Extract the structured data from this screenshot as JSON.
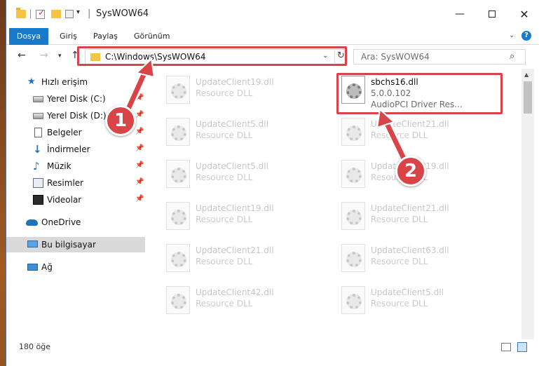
{
  "window": {
    "title": "SysWOW64"
  },
  "ribbon": {
    "tabs": [
      {
        "label": "Dosya"
      },
      {
        "label": "Giriş"
      },
      {
        "label": "Paylaş"
      },
      {
        "label": "Görünüm"
      }
    ],
    "help": "?"
  },
  "nav": {
    "address": "C:\\Windows\\SysWOW64",
    "search_placeholder": "Ara: SysWOW64"
  },
  "sidebar": {
    "items": [
      {
        "label": "Hızlı erişim",
        "icon": "star-icon"
      },
      {
        "label": "Yerel Disk (C:)",
        "icon": "drive-icon",
        "pinned": true
      },
      {
        "label": "Yerel Disk (D:)",
        "icon": "drive-icon",
        "pinned": true
      },
      {
        "label": "Belgeler",
        "icon": "document-icon",
        "pinned": true
      },
      {
        "label": "İndirmeler",
        "icon": "download-icon",
        "pinned": true
      },
      {
        "label": "Müzik",
        "icon": "music-icon",
        "pinned": true
      },
      {
        "label": "Resimler",
        "icon": "picture-icon",
        "pinned": true
      },
      {
        "label": "Videolar",
        "icon": "video-icon",
        "pinned": true
      },
      {
        "label": "OneDrive",
        "icon": "cloud-icon"
      },
      {
        "label": "Bu bilgisayar",
        "icon": "computer-icon",
        "selected": true
      },
      {
        "label": "Ağ",
        "icon": "network-icon"
      }
    ]
  },
  "files": {
    "left_column": [
      {
        "name": "UpdateClient19.dll",
        "type": "Resource DLL"
      },
      {
        "name": "UpdateClient5.dll",
        "type": "Resource DLL"
      },
      {
        "name": "UpdateClient5.dll",
        "type": "Resource DLL"
      },
      {
        "name": "UpdateClient19.dll",
        "type": "Resource DLL"
      },
      {
        "name": "UpdateClient21.dll",
        "type": "Resource DLL"
      },
      {
        "name": "UpdateClient42.dll",
        "type": "Resource DLL"
      }
    ],
    "right_column": [
      {
        "name": "sbchs16.dll",
        "type": "5.0.0.102",
        "desc": "AudioPCI Driver Res...",
        "active": true
      },
      {
        "name": "UpdateClient21.dll",
        "type": "Resource DLL"
      },
      {
        "name": "UpdateClient19.dll",
        "type": "Resource DLL"
      },
      {
        "name": "UpdateClient21.dll",
        "type": "Resource DLL"
      },
      {
        "name": "UpdateClient63.dll",
        "type": "Resource DLL"
      },
      {
        "name": "UpdateClient5.dll",
        "type": "Resource DLL"
      }
    ]
  },
  "status": {
    "count": "180 öğe"
  },
  "annotations": {
    "step1": "1",
    "step2": "2",
    "color": "#d84448"
  }
}
